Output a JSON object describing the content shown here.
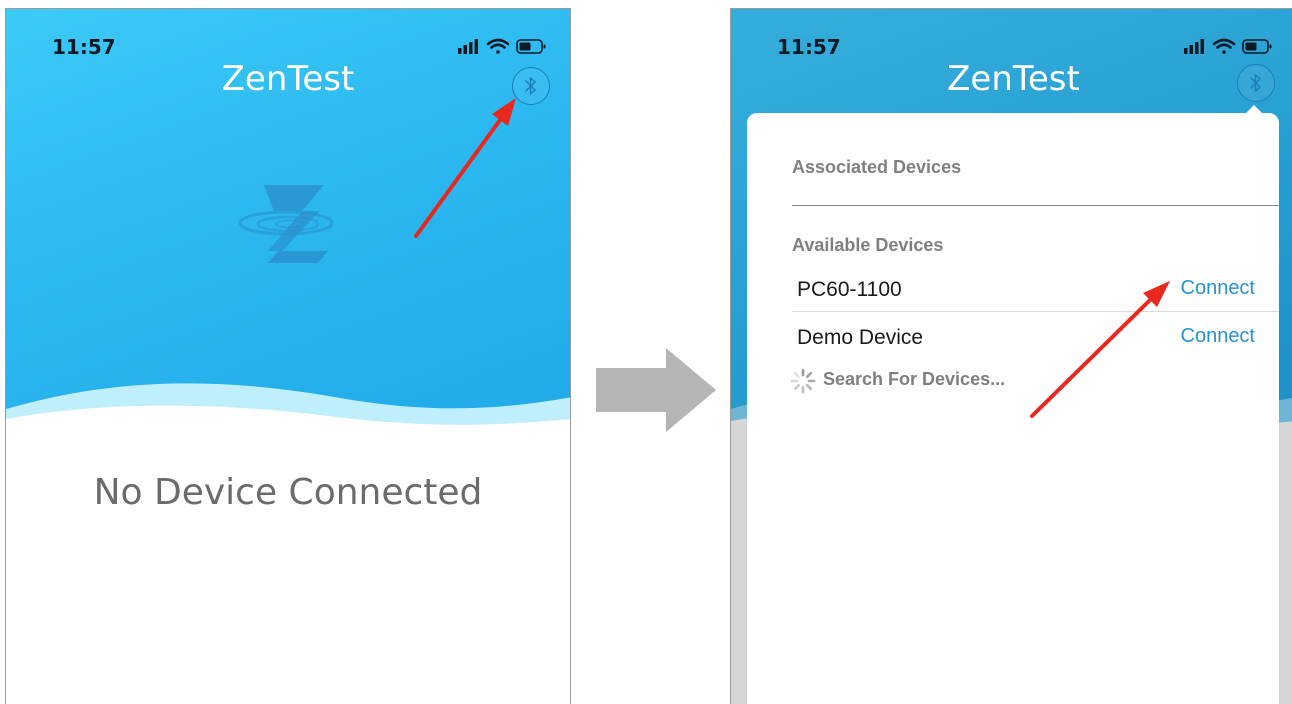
{
  "left_screen": {
    "status": {
      "time": "11:57"
    },
    "app_title": "ZenTest",
    "message": "No Device Connected"
  },
  "right_screen": {
    "status": {
      "time": "11:57"
    },
    "app_title": "ZenTest",
    "popover": {
      "associated_header": "Associated Devices",
      "available_header": "Available Devices",
      "devices": [
        {
          "name": "PC60-1100",
          "action": "Connect"
        },
        {
          "name": "Demo Device",
          "action": "Connect"
        }
      ],
      "search_label": "Search For Devices..."
    }
  },
  "colors": {
    "header_blue": "#2cb8f0",
    "link_blue": "#2593d3",
    "annotation_red": "#e8281e",
    "transition_arrow": "#b5b5b5"
  },
  "icons": [
    "bluetooth-icon",
    "signal-icon",
    "wifi-icon",
    "battery-icon",
    "zentest-logo-icon",
    "spinner-icon"
  ]
}
